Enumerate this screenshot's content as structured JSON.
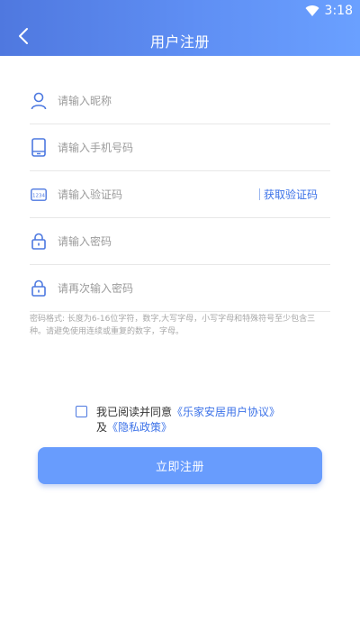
{
  "status_bar": {
    "time": "3:18",
    "wifi_icon": "wifi-icon"
  },
  "header": {
    "title": "用户注册",
    "back_icon": "chevron-left-icon"
  },
  "form": {
    "nickname_placeholder": "请输入昵称",
    "phone_placeholder": "请输入手机号码",
    "code_placeholder": "请输入验证码",
    "get_code_label": "获取验证码",
    "password_placeholder": "请输入密码",
    "confirm_password_placeholder": "请再次输入密码"
  },
  "password_hint": "密码格式: 长度为6-16位字符，数字,大写字母，小写字母和特殊符号至少包含三种。请避免使用连续或重复的数字，字母。",
  "agreement": {
    "prefix": "我已阅读并同意",
    "user_agreement": "《乐家安居用户协议》",
    "and": "及",
    "privacy_policy": "《隐私政策》"
  },
  "register_button": "立即注册",
  "colors": {
    "accent": "#4c78e0",
    "button": "#689cfd",
    "link": "#3c72e8"
  }
}
